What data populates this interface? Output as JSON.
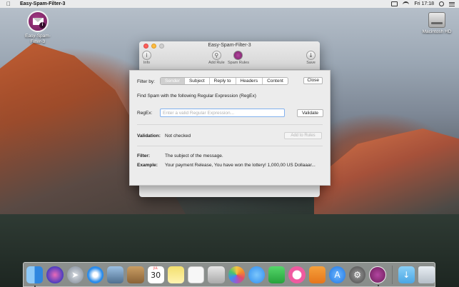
{
  "menubar": {
    "app_name": "Easy-Spam-Filter-3",
    "clock": "Fri 17:18"
  },
  "desktop": {
    "app_icon_label": "Easy-Spam-Filter-3",
    "app_icon_badge": "i",
    "drive_label": "Macintosh HD"
  },
  "window": {
    "title": "Easy-Spam-Filter-3",
    "toolbar": {
      "info_label": "Info",
      "add_rule_label": "Add Rule",
      "spam_rules_label": "Spam Rules",
      "save_label": "Save"
    }
  },
  "sheet": {
    "filter_by_label": "Filter by:",
    "segments": [
      "Sender",
      "Subject",
      "Reply to",
      "Headers",
      "Content"
    ],
    "selected_segment": "Sender",
    "close_label": "Close",
    "find_text": "Find Spam with the following Regular Expression (RegEx)",
    "regex_label": "RegEx:",
    "regex_placeholder": "Enter a valid Regular Expression...",
    "regex_value": "",
    "validate_label": "Validate",
    "validation_label": "Validation:",
    "validation_value": "Not checked",
    "add_to_rules_label": "Add to Rules",
    "filter_label": "Filter:",
    "filter_value": "The subject of the message.",
    "example_label": "Example:",
    "example_value": "Your payment Release, You have won the lottery! 1,000,00 US Dollaaar..."
  },
  "dock": {
    "calendar_day": "30",
    "calendar_month": "JUL",
    "apps": [
      {
        "name": "finder",
        "color": "#3d9bf0"
      },
      {
        "name": "siri",
        "color": "#5b3fb5"
      },
      {
        "name": "launchpad",
        "color": "#8e98a6"
      },
      {
        "name": "safari",
        "color": "#2a8bea"
      },
      {
        "name": "preview",
        "color": "#6f8aa8"
      },
      {
        "name": "contacts",
        "color": "#b98a55"
      },
      {
        "name": "calendar",
        "color": "#ffffff"
      },
      {
        "name": "notes",
        "color": "#f6e27a"
      },
      {
        "name": "reminders",
        "color": "#f5f5f5"
      },
      {
        "name": "photo-booth",
        "color": "#d9d9d9"
      },
      {
        "name": "photos",
        "color": "#f0f0f0"
      },
      {
        "name": "messages",
        "color": "#4aaaf5"
      },
      {
        "name": "facetime",
        "color": "#3dbd4e"
      },
      {
        "name": "itunes",
        "color": "#f04a8c"
      },
      {
        "name": "ibooks",
        "color": "#f2912b"
      },
      {
        "name": "app-store",
        "color": "#2f8ff0"
      },
      {
        "name": "system-preferences",
        "color": "#6b6b6b"
      },
      {
        "name": "easy-spam-filter",
        "color": "#8a2b74"
      }
    ]
  }
}
